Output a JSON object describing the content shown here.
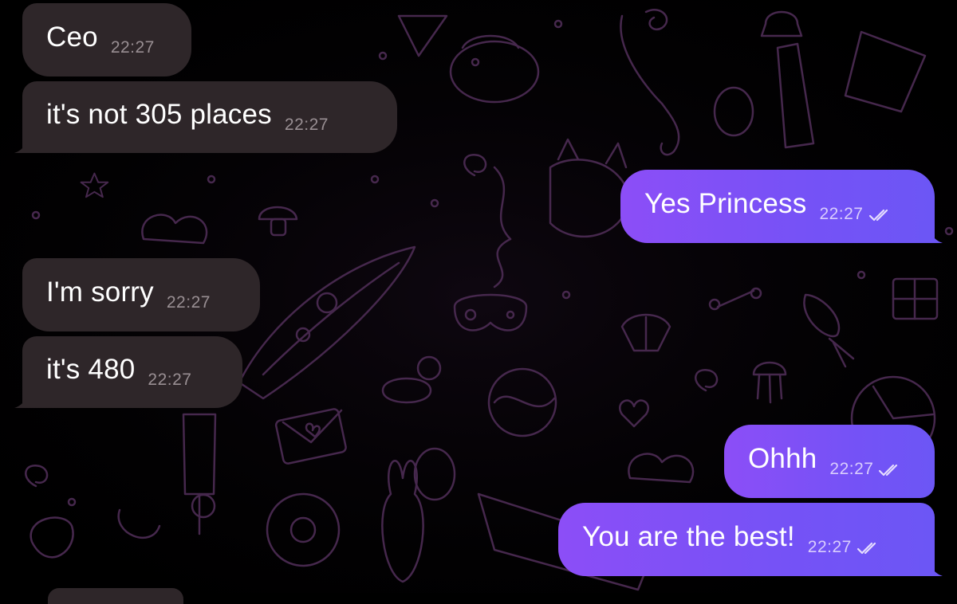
{
  "chat": {
    "messages": [
      {
        "direction": "incoming",
        "text": "Ceo",
        "time": "22:27"
      },
      {
        "direction": "incoming",
        "text": "it's not 305 places",
        "time": "22:27"
      },
      {
        "direction": "outgoing",
        "text": "Yes Princess",
        "time": "22:27",
        "status": "read"
      },
      {
        "direction": "incoming",
        "text": "I'm sorry",
        "time": "22:27"
      },
      {
        "direction": "incoming",
        "text": "it's 480",
        "time": "22:27"
      },
      {
        "direction": "outgoing",
        "text": "Ohhh",
        "time": "22:27",
        "status": "read"
      },
      {
        "direction": "outgoing",
        "text": "You are the best!",
        "time": "22:27",
        "status": "read"
      }
    ]
  },
  "theme": {
    "incoming_bubble": "#2e2629",
    "outgoing_bubble_start": "#8c4ef7",
    "outgoing_bubble_end": "#6c56f5",
    "background": "#000000",
    "pattern_color": "#4b2a52",
    "read_icon": "double-check-icon"
  }
}
